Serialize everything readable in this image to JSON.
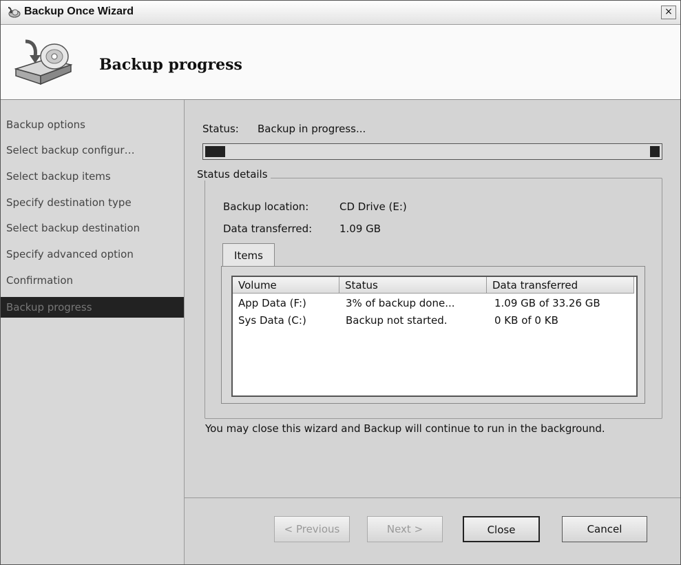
{
  "window": {
    "title": "Backup Once Wizard",
    "close_glyph": "×"
  },
  "header": {
    "title": "Backup progress",
    "icon": "backup-wizard-icon"
  },
  "sidebar": {
    "items": [
      {
        "label": "Backup options"
      },
      {
        "label": "Select backup configur…"
      },
      {
        "label": "Select backup items"
      },
      {
        "label": "Specify destination type"
      },
      {
        "label": "Select backup destination"
      },
      {
        "label": "Specify advanced option"
      },
      {
        "label": "Confirmation"
      },
      {
        "label": "Backup progress"
      }
    ],
    "active_index": 7
  },
  "status": {
    "label": "Status:",
    "value": "Backup in progress...",
    "progress_fraction": 0.03
  },
  "details": {
    "group_title": "Status details",
    "location_label": "Backup location:",
    "location_value": "CD Drive (E:)",
    "transferred_label": "Data transferred:",
    "transferred_value": "1.09 GB"
  },
  "tabs": [
    {
      "label": "Items"
    }
  ],
  "items_table": {
    "columns": [
      "Volume",
      "Status",
      "Data transferred"
    ],
    "rows": [
      [
        "App Data (F:)",
        "3% of backup done...",
        "1.09 GB of 33.26 GB"
      ],
      [
        "Sys Data (C:)",
        "Backup not started.",
        "0 KB of 0 KB"
      ]
    ]
  },
  "note": "You may close this wizard and Backup will continue to run in the background.",
  "buttons": {
    "previous": "< Previous",
    "next": "Next >",
    "close": "Close",
    "cancel": "Cancel"
  }
}
